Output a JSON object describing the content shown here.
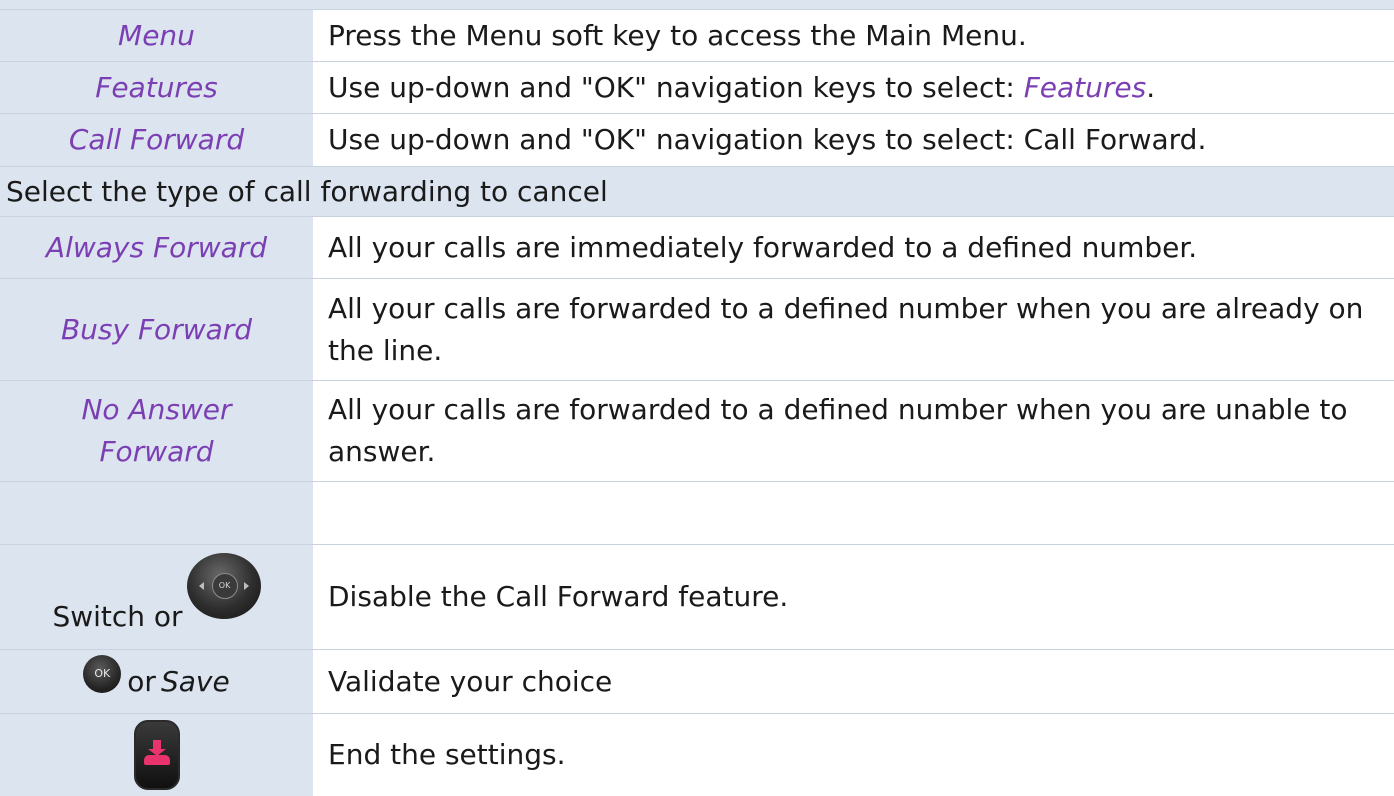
{
  "steps": [
    {
      "term": "Menu",
      "desc": "Press the Menu soft key to access the Main Menu."
    },
    {
      "term": "Features",
      "desc_prefix": "Use up-down and \"OK\" navigation keys to select: ",
      "desc_em": "Features",
      "desc_suffix": "."
    },
    {
      "term": "Call Forward",
      "desc": "Use up-down and \"OK\" navigation keys to select: Call Forward."
    }
  ],
  "section_heading": "Select the type of call forwarding to cancel",
  "forward_types": [
    {
      "term": "Always Forward",
      "desc": "All your calls are immediately forwarded to a defined number."
    },
    {
      "term": "Busy Forward",
      "desc": "All your calls are forwarded to a defined number when you are already on the line."
    },
    {
      "term": "No Answer Forward",
      "desc": "All your calls are forwarded to a defined number when you are unable to answer."
    }
  ],
  "actions": {
    "switch": {
      "label_prefix": "Switch or",
      "icon_text": "OK",
      "desc": "Disable the Call Forward feature."
    },
    "validate": {
      "icon_text": "OK",
      "label_or": "or",
      "label_save": "Save",
      "desc": "Validate your choice"
    },
    "end": {
      "desc": "End the settings."
    }
  },
  "icons": {
    "nav": "navigation-key-icon",
    "ok": "ok-key-icon",
    "hangup": "hang-up-key-icon"
  },
  "colors": {
    "label_bg": "#dbe4ef",
    "term_text": "#7b3fb3",
    "hangup_accent": "#e8336d"
  }
}
